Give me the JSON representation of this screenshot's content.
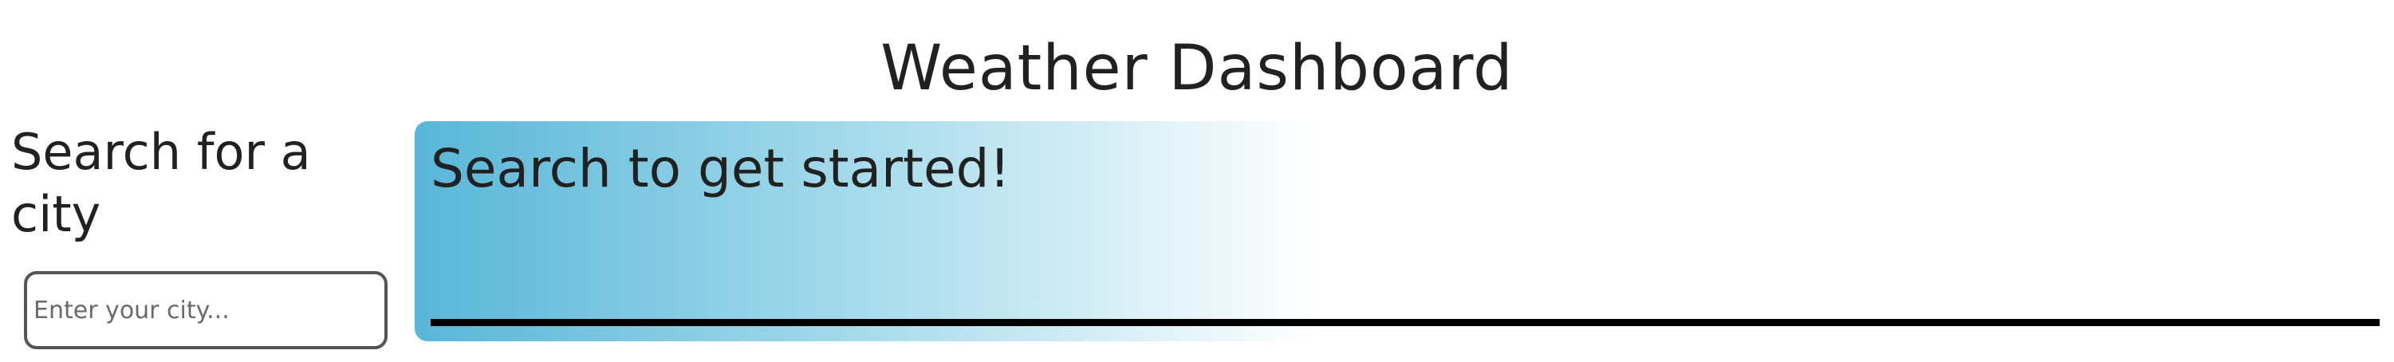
{
  "header": {
    "title": "Weather Dashboard"
  },
  "sidebar": {
    "heading": "Search for a city",
    "search": {
      "placeholder": "Enter your city...",
      "value": ""
    }
  },
  "main": {
    "heading": "Search to get started!"
  },
  "colors": {
    "panel_gradient_start": "#58b6d8",
    "panel_gradient_mid": "#a6dbeb",
    "panel_gradient_end": "#ffffff",
    "text": "#212121",
    "divider": "#000000"
  }
}
